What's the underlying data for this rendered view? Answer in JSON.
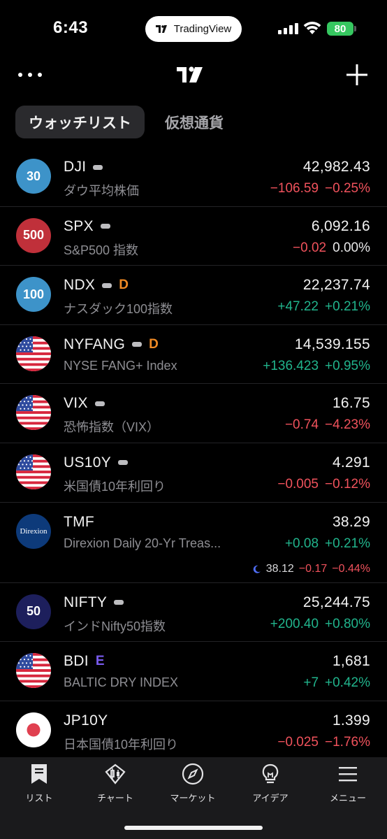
{
  "status_bar": {
    "time": "6:43",
    "pill_label": "TradingView",
    "battery": "80"
  },
  "header": {
    "more_icon": "more-dots-icon",
    "logo": "tradingview-logo",
    "add_icon": "plus-icon"
  },
  "tabs": [
    {
      "label": "ウォッチリスト",
      "active": true
    },
    {
      "label": "仮想通貨",
      "active": false
    }
  ],
  "colors": {
    "negative": "#f0525c",
    "positive": "#21b48c",
    "badge_orange": "#f08a24",
    "badge_purple": "#7a5cf0",
    "background": "#000000"
  },
  "watchlist": [
    {
      "symbol": "DJI",
      "badge": "dash",
      "avatar_text": "30",
      "avatar_kind": "circle-blue",
      "desc": "ダウ平均株価",
      "price": "42,982.43",
      "change": "−106.59",
      "change_pct": "−0.25%",
      "direction": "neg"
    },
    {
      "symbol": "SPX",
      "badge": "dash",
      "avatar_text": "500",
      "avatar_kind": "circle-red",
      "desc": "S&P500 指数",
      "price": "6,092.16",
      "change": "−0.02",
      "change_pct": "0.00%",
      "direction": "mixed"
    },
    {
      "symbol": "NDX",
      "badge": "dash",
      "badge_letter": "D",
      "avatar_text": "100",
      "avatar_kind": "circle-blue",
      "desc": "ナスダック100指数",
      "price": "22,237.74",
      "change": "+47.22",
      "change_pct": "+0.21%",
      "direction": "pos"
    },
    {
      "symbol": "NYFANG",
      "badge": "dash",
      "badge_letter": "D",
      "avatar_text": "",
      "avatar_kind": "us-flag",
      "desc": "NYSE FANG+ Index",
      "price": "14,539.155",
      "change": "+136.423",
      "change_pct": "+0.95%",
      "direction": "pos"
    },
    {
      "symbol": "VIX",
      "badge": "dash",
      "avatar_text": "",
      "avatar_kind": "us-flag",
      "desc": "恐怖指数（VIX）",
      "price": "16.75",
      "change": "−0.74",
      "change_pct": "−4.23%",
      "direction": "neg"
    },
    {
      "symbol": "US10Y",
      "badge": "dash",
      "avatar_text": "",
      "avatar_kind": "us-flag",
      "desc": "米国債10年利回り",
      "price": "4.291",
      "change": "−0.005",
      "change_pct": "−0.12%",
      "direction": "neg"
    },
    {
      "symbol": "TMF",
      "badge": "",
      "avatar_text": "Direxion",
      "avatar_kind": "direxion",
      "desc": "Direxion Daily 20-Yr Treas...",
      "price": "38.29",
      "change": "+0.08",
      "change_pct": "+0.21%",
      "direction": "pos",
      "extended": {
        "icon": "moon-icon",
        "price": "38.12",
        "change": "−0.17",
        "change_pct": "−0.44%"
      }
    },
    {
      "symbol": "NIFTY",
      "badge": "dash",
      "avatar_text": "50",
      "avatar_kind": "circle-navy",
      "desc": "インドNifty50指数",
      "price": "25,244.75",
      "change": "+200.40",
      "change_pct": "+0.80%",
      "direction": "pos"
    },
    {
      "symbol": "BDI",
      "badge": "",
      "badge_letter": "E",
      "avatar_text": "",
      "avatar_kind": "us-flag",
      "desc": "BALTIC DRY INDEX",
      "price": "1,681",
      "change": "+7",
      "change_pct": "+0.42%",
      "direction": "pos"
    },
    {
      "symbol": "JP10Y",
      "badge": "",
      "avatar_text": "",
      "avatar_kind": "jp-flag",
      "desc": "日本国債10年利回り",
      "price": "1.399",
      "change": "−0.025",
      "change_pct": "−1.76%",
      "direction": "neg"
    }
  ],
  "tab_bar": [
    {
      "label": "リスト",
      "icon": "bookmark-list-icon"
    },
    {
      "label": "チャート",
      "icon": "candlestick-chart-icon"
    },
    {
      "label": "マーケット",
      "icon": "compass-icon"
    },
    {
      "label": "アイデア",
      "icon": "lightbulb-icon"
    },
    {
      "label": "メニュー",
      "icon": "hamburger-menu-icon"
    }
  ]
}
